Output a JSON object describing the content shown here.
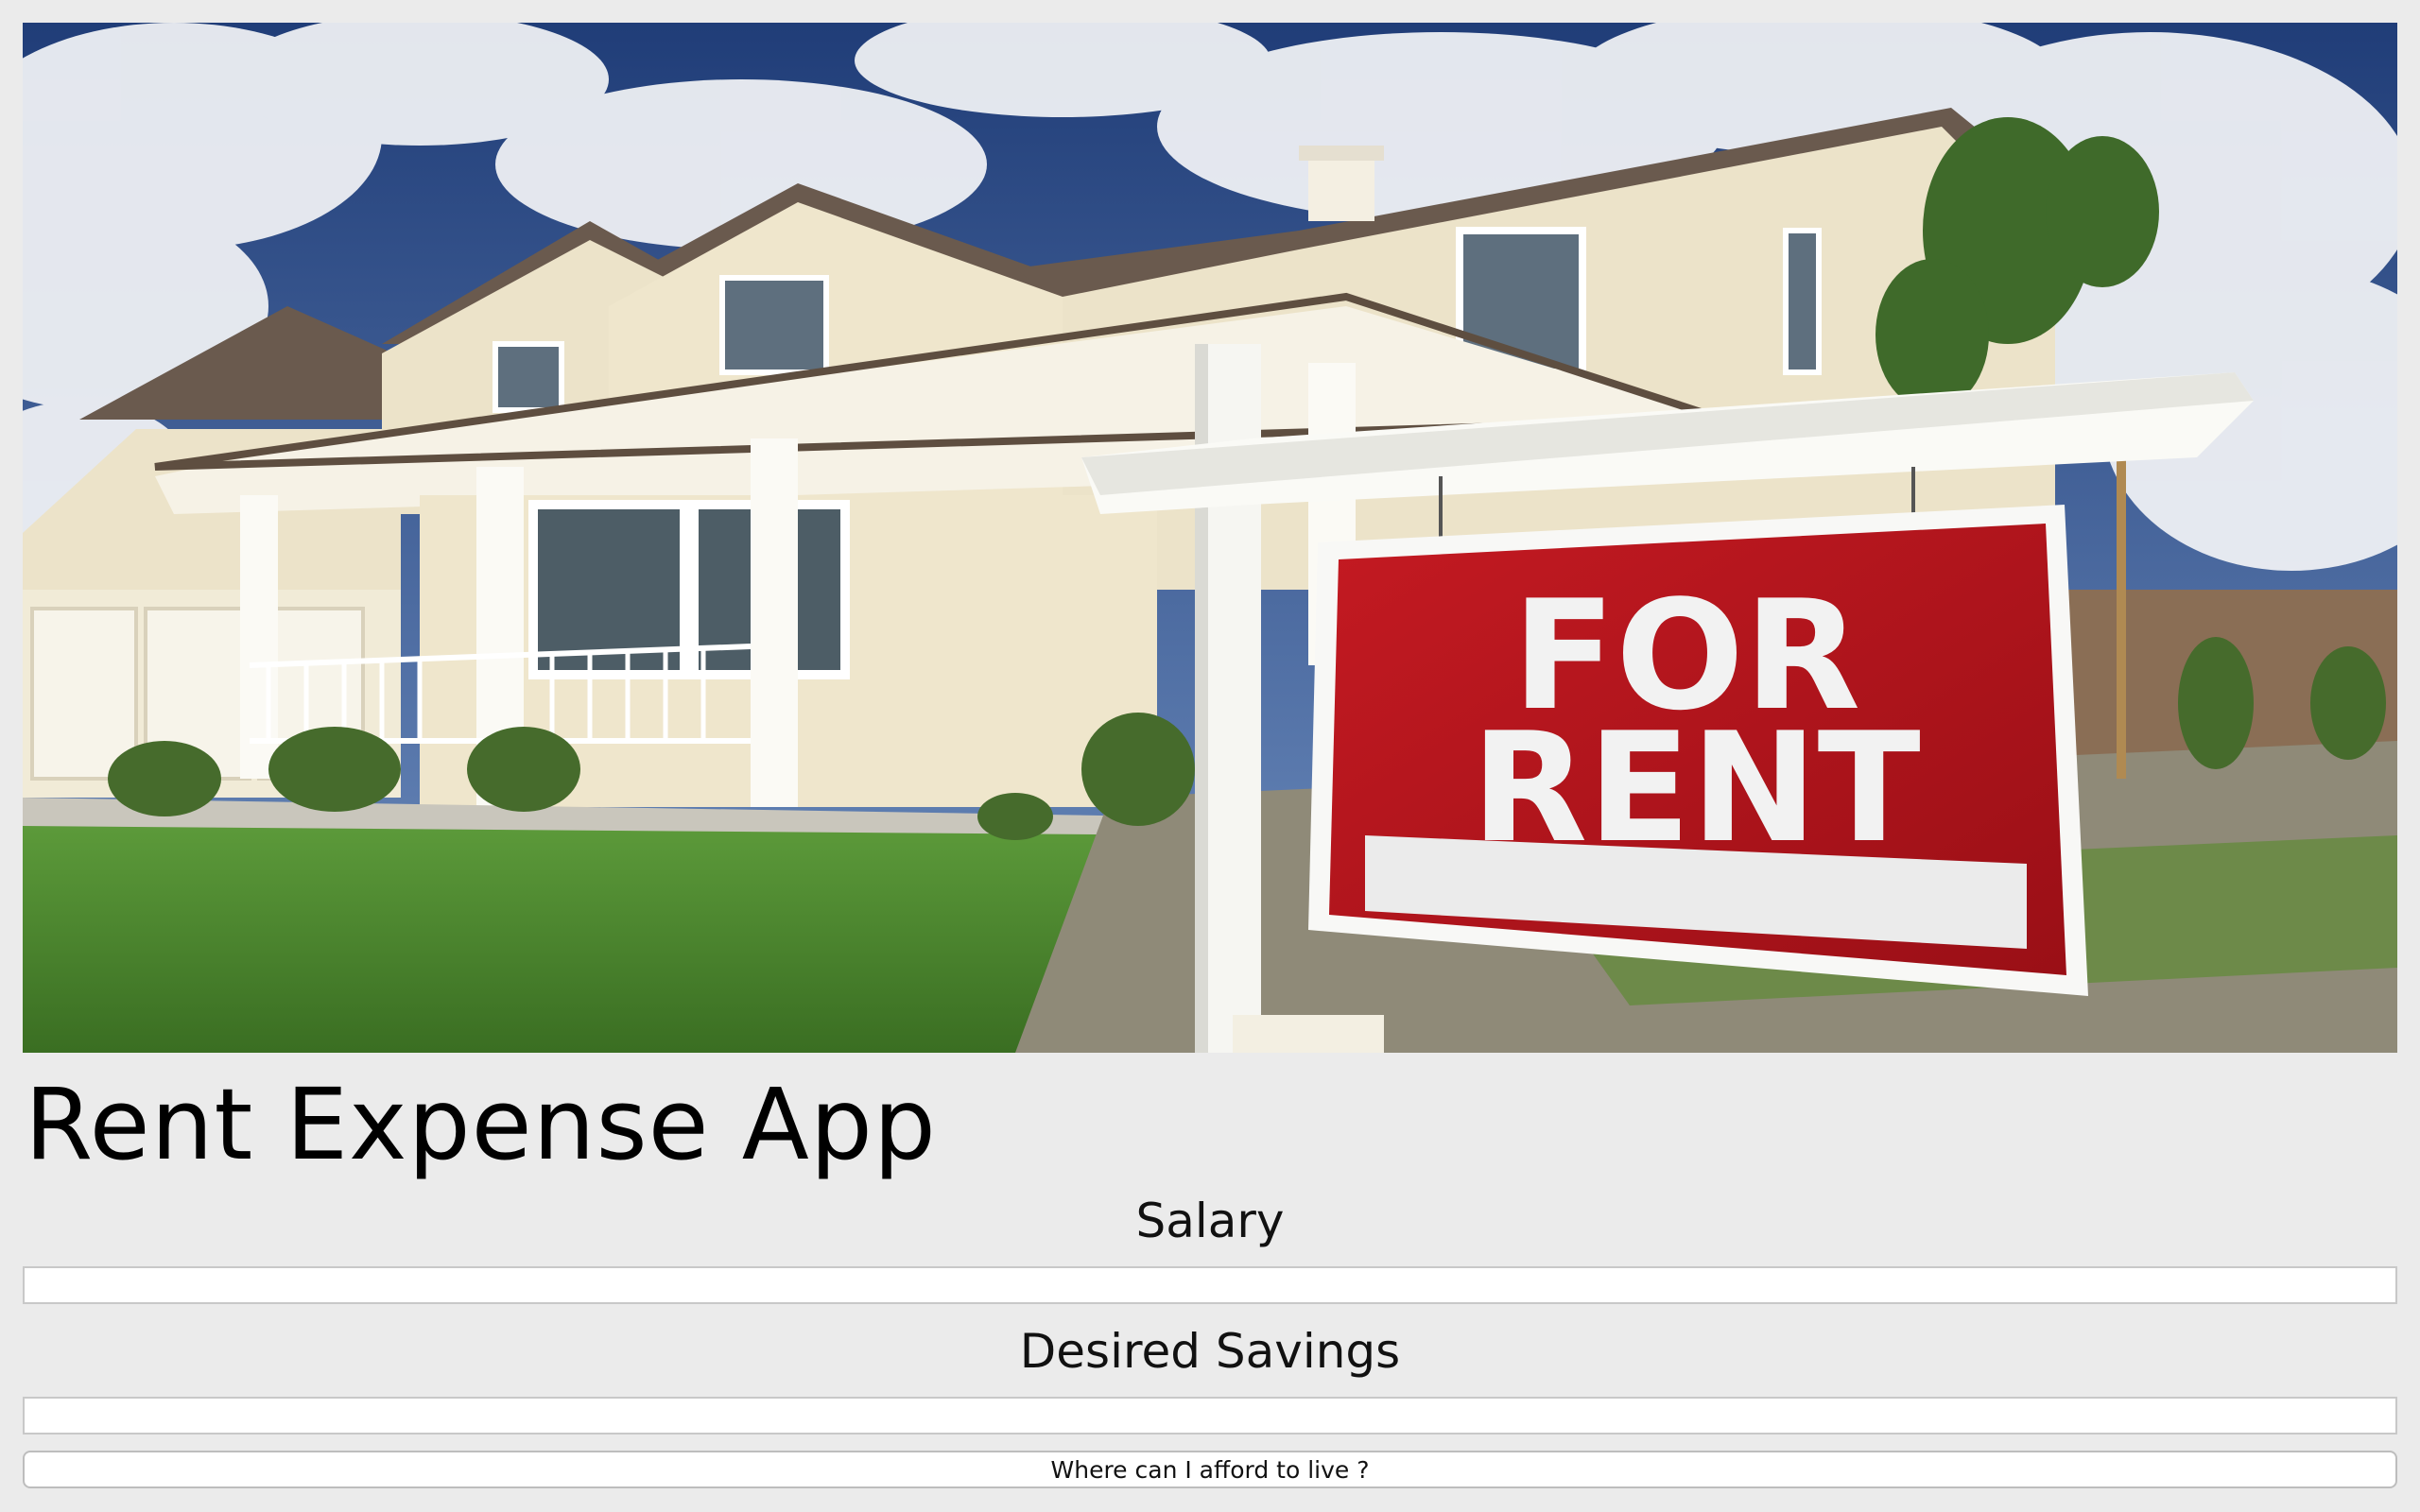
{
  "app": {
    "title": "Rent Expense App"
  },
  "hero": {
    "sign_line1": "FOR",
    "sign_line2": "RENT",
    "sign_color": "#b0131b"
  },
  "form": {
    "salary_label": "Salary",
    "salary_value": "",
    "savings_label": "Desired Savings",
    "savings_value": "",
    "submit_label": "Where can I afford to live ?"
  }
}
